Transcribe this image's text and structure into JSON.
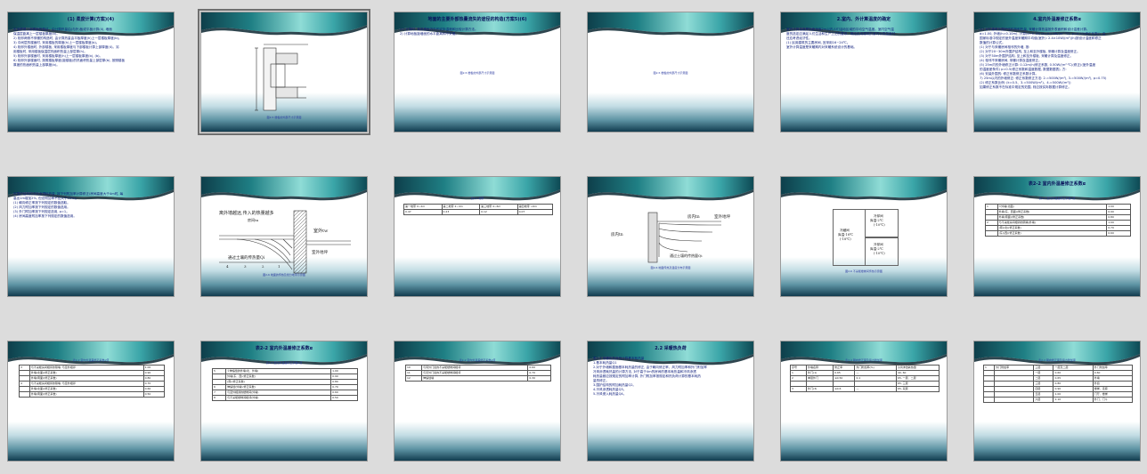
{
  "slides": [
    {
      "id": 1,
      "title": "(1) 柔度计算(方案)(4)",
      "lines": [
        "应该根据上部楼面的做法、由计算热量由(与外)板或平板计算(4), 墙面",
        "保温层距离上一层楼板厚度(b)。",
        "2) 相邻两侧不采暖的构造时, 由计算热量由平板厚度(h)上一层楼板厚度(b)。",
        "3) 中间层的楼面时, 采用楼板的厚度(h)上一层楼板厚度(b)。",
        "4) 相邻外楼面时, 外部楼板, 采用楼板厚度与下部楼板计算上部厚度(4)。另",
        "用楼板时, 采用楼板保温层热面积热量上部层厚(h)。",
        "5) 相邻外部楼面时, 采用楼板厚度(h)上一层楼板厚度(b), (b)。",
        "6) 相邻外部楼面时, 按照楼板厚度(距楼板)的热面积热量上部层厚(b), 按照楼板",
        "厚度的热面积热量上部厚度(b)。"
      ]
    },
    {
      "id": 2,
      "caption": "图2-5  楼板的外部尺寸示意图"
    },
    {
      "id": 3,
      "title": "地面的主要外部热量流失的途径的构造(方案5)(6)",
      "lines": [
        "(1) 计算时, 采用楼板内外的实际温度和比较计算方法。",
        "2) 计算地板距墙面的水平距离和不采暖。"
      ],
      "caption": "图2-5  楼板的外部尺寸示意图"
    },
    {
      "id": 4,
      "caption": "图2-5  楼板的外部尺寸示意图"
    },
    {
      "id": 5,
      "title": "2.室内、外计算温度的确定",
      "lines": [
        "室内计算温度是指距地面2m以内人们活动区域的平均空气温度。室内空气温",
        "度的选定应满足人们生活和生产工艺的要求。确定民用建筑的室内计算温度时",
        "还应考虑经济性。",
        "(1) 民用建筑的主要房间, 宜采用16~24℃。",
        "室外计算温度是采暖期内对采暖系统设计的基础。"
      ]
    },
    {
      "id": 6,
      "title": "4.室内外温差修正系数α",
      "lines": [
        "(1) 对于建筑外围护结构的耐热量, 采暖计算热量按外表面积和设计温差计算。",
        "α=1.00, 外墙(h=0.10m), 计算(α=0.18) (k=0.23W/(m²·℃), p=0.43(修正系数)), 由",
        "国家标准中规定的室外温度采暖期平均值(室外): 2.4×10W/(m²)(h)按设计温度和修正",
        "数值的计算公式。",
        "(1) 对于与采暖房间相邻的外墙, 按:",
        "(2) 对于20~30m外围护结构, 至上和至外楼板, 采暖计算及温度修正。",
        "(3) 对于30m外围护结构, 至上和至外楼板, 采暖计算及温度修正。",
        "(4) 相邻不采暖房间, 采暖计算及温度修正。",
        "(5) 25m内的外墙修正计算: 0.12m(h)修正系数, 0.50W/(m²·℃)(修正)(室外温度",
        "的温度差条件) p=0.5(修正系数和温度数据, 数据数据表), 方:",
        "(6) 安装外围的: 修正系数修正系数计算。",
        "7) 25m以内的外墙修正: 修正系数修正方法: 2.=500W/(m²), 3.=500W/(m²), p=0.75)",
        "(2) 修正系数比例: (k=0.5、3.=500W/(m²)、4.=500W/(m²))",
        "如果修正系数不在标准中规定的范围, 则应按实际数据计算修正。"
      ]
    },
    {
      "id": 7,
      "lines": [
        "外围护结构的冷风渗透耗热量, 按下列附加率计算修正(房间高度大于4m时, 每",
        "高出1m增加2%, 但总附加率不应大于15%)。",
        "(1) 朝向修正率按下列规定的数值选取。",
        "(2) 风力附加率按下列规定的数值选用。",
        "(3) 外门附加率按下列规定选用, p=1。",
        "(4) 房间高度附加率按下列规定的数值选用。"
      ]
    },
    {
      "id": 8,
      "caption": "图2-6  地面的传热及划分地带示意图",
      "labels": [
        "离外墙越远,传入的热量越多",
        "房间tn",
        "室外tw",
        "室外地坪",
        "通过土壤的传热量Qi",
        "4",
        "3",
        "2",
        "1"
      ]
    },
    {
      "id": 9,
      "caption": "表2-1  地带",
      "table": [
        [
          "第一地带 0~2m",
          "第二地带 2~4m",
          "第三地带 4~6m",
          "第四地带 >6m"
        ],
        [
          "0.47",
          "0.23",
          "0.12",
          "0.07"
        ]
      ]
    },
    {
      "id": 10,
      "caption": "图2-6  地面传热及温度分布示意图",
      "labels": [
        "房内tn",
        "室外地坪",
        "房内tn",
        "通过土壤的传热量Qi"
      ]
    },
    {
      "id": 11,
      "caption": "图2-6  不采暖楼梯间传热示意图",
      "labels": [
        "冷藏间",
        "库温-18℃",
        "(-18℃)",
        "冷却间",
        "库温-2℃",
        "(-10℃)",
        "冷却间",
        "库温-2℃",
        "(-10℃)"
      ]
    },
    {
      "id": 12,
      "title": "表2-2  室内外温差修正系数α",
      "caption": "表2-2  室内外温差修正系数α值",
      "rows": [
        [
          "1",
          "①外墙(北面)",
          "1.00"
        ],
        [
          "",
          "外墙(东、西面)(修正系数)",
          "0.90"
        ],
        [
          "",
          "外墙(南面)(修正系数)",
          "0.80"
        ],
        [
          "2",
          "与不采暖房间相邻的隔墙(外墙)",
          "1.00"
        ],
        [
          "",
          "(南)(北)(修正系数)",
          "0.70"
        ],
        [
          "",
          "(东)(西)(修正系数)",
          "0.60"
        ]
      ]
    },
    {
      "id": 13,
      "caption": "表2-2  室内外温差修正系数α值",
      "rows": [
        [
          "3",
          "与不采暖房间相邻的隔墙, 与室外相邻",
          "1.00"
        ],
        [
          "",
          "外墙(北面)(修正系数)",
          "0.90"
        ],
        [
          "",
          "外墙(南面)(修正系数)",
          "0.80"
        ],
        [
          "4",
          "与不采暖房间相邻的隔墙, 与室外相邻",
          "0.70"
        ],
        [
          "",
          "外墙(北面)(修正系数)",
          "0.60"
        ],
        [
          "",
          "外墙(南面)(修正系数)",
          "0.50"
        ]
      ]
    },
    {
      "id": 14,
      "title": "表2-2  室内外温差修正系数α",
      "caption": "表2-2  室内外温差修正系数α值",
      "rows": [
        [
          "5",
          "①伸缩缝的外墙(北、外墙)",
          "1.00"
        ],
        [
          "",
          "外墙(东、西)(修正系数)",
          "0.90"
        ],
        [
          "",
          "(南)(修正系数)",
          "0.80"
        ],
        [
          "6",
          "伸缩缝(外墙)(修正系数)",
          "0.70"
        ],
        [
          "7",
          "与室外相通的楼梯间(外墙)",
          "0.60"
        ],
        [
          "8",
          "与不采暖楼梯间相邻(外墙)",
          "0.50"
        ]
      ]
    },
    {
      "id": 15,
      "caption": "表2-2  室内外温差修正系数α值",
      "rows": [
        [
          "10",
          "与有外门窗的不采暖楼梯间相邻",
          "0.60"
        ],
        [
          "11",
          "与无外门窗的不采暖楼梯间相邻",
          "0.70"
        ],
        [
          "12",
          "伸缩缝墙",
          "0.30"
        ]
      ]
    },
    {
      "id": 16,
      "title": "2.2  采暖热负荷",
      "lines": [
        "表2-3  采暖热负荷的计算基本耗热量",
        "1.基本耗热量Q1",
        "2.对于外墙和屋面基本耗热量的修正, 由于朝向修正率、风力附加率和外门附加率",
        "冷风渗透耗热量的计算方法, 对于高于4m的房间的基本耗热量和冷风渗透",
        "耗热量都应按规定的附加率计算, 外门附加率按规定和热负荷计算的基本耗热",
        "量的修正。",
        "3.围护结构的附加耗热量Q2。",
        "4.冷风渗透耗热量Q3。",
        "5.冷风侵入耗热量Q4。"
      ]
    },
    {
      "id": 17,
      "caption": "表2-4  朝向修正率及风力附加率",
      "rows": [
        [
          "序号",
          "外墙名称",
          "修正率",
          "外门附加率(%)",
          "冷风渗透耗热量"
        ],
        [
          "1",
          "外门(1)",
          "0.65",
          "—",
          "40, 60"
        ],
        [
          "2",
          "单层外门",
          "≤0.50",
          "0.1",
          "65, 一层、二层"
        ],
        [
          "",
          "",
          "",
          "",
          "65, 三层"
        ],
        [
          "3",
          "外门(3)",
          "≤0.6",
          "—",
          "65, 双层"
        ]
      ]
    },
    {
      "id": 18,
      "caption": "表2-4  朝向修正率及风力附加率",
      "rows": [
        [
          "1",
          "外门附加率",
          "三层",
          "一层及二层",
          "外门附加率"
        ],
        [
          "",
          "",
          "一层",
          "0.60",
          "0.60"
        ],
        [
          "",
          "",
          "二层",
          "0.65",
          "外墙"
        ],
        [
          "",
          "",
          "三层",
          "0.80",
          "外窗"
        ],
        [
          "",
          "",
          "四层",
          "0.90",
          "楼梯、走廊"
        ],
        [
          "",
          "",
          "五层",
          "1.00",
          "门厅、楼梯"
        ],
        [
          "",
          "",
          "六层",
          "1.10",
          "外门、门斗"
        ]
      ]
    }
  ]
}
